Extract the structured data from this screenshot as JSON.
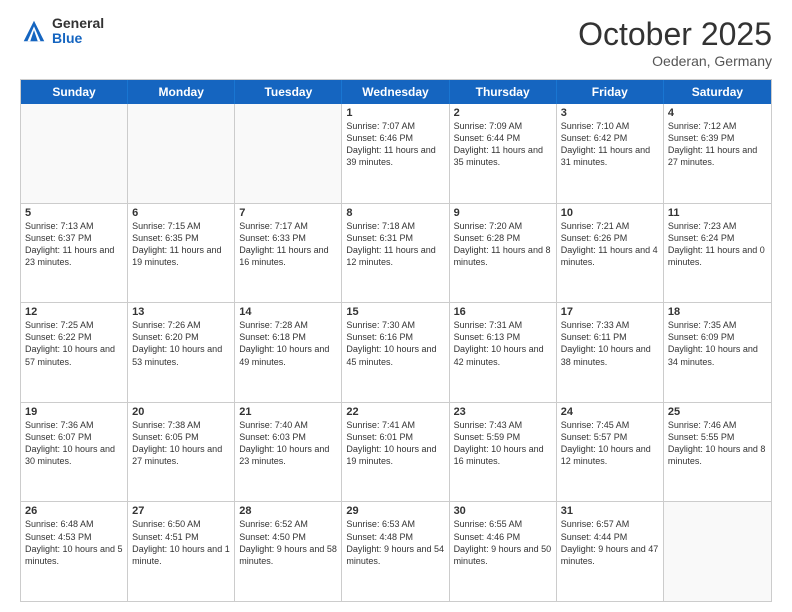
{
  "header": {
    "logo": {
      "general": "General",
      "blue": "Blue"
    },
    "title": "October 2025",
    "location": "Oederan, Germany"
  },
  "weekdays": [
    "Sunday",
    "Monday",
    "Tuesday",
    "Wednesday",
    "Thursday",
    "Friday",
    "Saturday"
  ],
  "rows": [
    [
      {
        "day": "",
        "sunrise": "",
        "sunset": "",
        "daylight": ""
      },
      {
        "day": "",
        "sunrise": "",
        "sunset": "",
        "daylight": ""
      },
      {
        "day": "",
        "sunrise": "",
        "sunset": "",
        "daylight": ""
      },
      {
        "day": "1",
        "sunrise": "Sunrise: 7:07 AM",
        "sunset": "Sunset: 6:46 PM",
        "daylight": "Daylight: 11 hours and 39 minutes."
      },
      {
        "day": "2",
        "sunrise": "Sunrise: 7:09 AM",
        "sunset": "Sunset: 6:44 PM",
        "daylight": "Daylight: 11 hours and 35 minutes."
      },
      {
        "day": "3",
        "sunrise": "Sunrise: 7:10 AM",
        "sunset": "Sunset: 6:42 PM",
        "daylight": "Daylight: 11 hours and 31 minutes."
      },
      {
        "day": "4",
        "sunrise": "Sunrise: 7:12 AM",
        "sunset": "Sunset: 6:39 PM",
        "daylight": "Daylight: 11 hours and 27 minutes."
      }
    ],
    [
      {
        "day": "5",
        "sunrise": "Sunrise: 7:13 AM",
        "sunset": "Sunset: 6:37 PM",
        "daylight": "Daylight: 11 hours and 23 minutes."
      },
      {
        "day": "6",
        "sunrise": "Sunrise: 7:15 AM",
        "sunset": "Sunset: 6:35 PM",
        "daylight": "Daylight: 11 hours and 19 minutes."
      },
      {
        "day": "7",
        "sunrise": "Sunrise: 7:17 AM",
        "sunset": "Sunset: 6:33 PM",
        "daylight": "Daylight: 11 hours and 16 minutes."
      },
      {
        "day": "8",
        "sunrise": "Sunrise: 7:18 AM",
        "sunset": "Sunset: 6:31 PM",
        "daylight": "Daylight: 11 hours and 12 minutes."
      },
      {
        "day": "9",
        "sunrise": "Sunrise: 7:20 AM",
        "sunset": "Sunset: 6:28 PM",
        "daylight": "Daylight: 11 hours and 8 minutes."
      },
      {
        "day": "10",
        "sunrise": "Sunrise: 7:21 AM",
        "sunset": "Sunset: 6:26 PM",
        "daylight": "Daylight: 11 hours and 4 minutes."
      },
      {
        "day": "11",
        "sunrise": "Sunrise: 7:23 AM",
        "sunset": "Sunset: 6:24 PM",
        "daylight": "Daylight: 11 hours and 0 minutes."
      }
    ],
    [
      {
        "day": "12",
        "sunrise": "Sunrise: 7:25 AM",
        "sunset": "Sunset: 6:22 PM",
        "daylight": "Daylight: 10 hours and 57 minutes."
      },
      {
        "day": "13",
        "sunrise": "Sunrise: 7:26 AM",
        "sunset": "Sunset: 6:20 PM",
        "daylight": "Daylight: 10 hours and 53 minutes."
      },
      {
        "day": "14",
        "sunrise": "Sunrise: 7:28 AM",
        "sunset": "Sunset: 6:18 PM",
        "daylight": "Daylight: 10 hours and 49 minutes."
      },
      {
        "day": "15",
        "sunrise": "Sunrise: 7:30 AM",
        "sunset": "Sunset: 6:16 PM",
        "daylight": "Daylight: 10 hours and 45 minutes."
      },
      {
        "day": "16",
        "sunrise": "Sunrise: 7:31 AM",
        "sunset": "Sunset: 6:13 PM",
        "daylight": "Daylight: 10 hours and 42 minutes."
      },
      {
        "day": "17",
        "sunrise": "Sunrise: 7:33 AM",
        "sunset": "Sunset: 6:11 PM",
        "daylight": "Daylight: 10 hours and 38 minutes."
      },
      {
        "day": "18",
        "sunrise": "Sunrise: 7:35 AM",
        "sunset": "Sunset: 6:09 PM",
        "daylight": "Daylight: 10 hours and 34 minutes."
      }
    ],
    [
      {
        "day": "19",
        "sunrise": "Sunrise: 7:36 AM",
        "sunset": "Sunset: 6:07 PM",
        "daylight": "Daylight: 10 hours and 30 minutes."
      },
      {
        "day": "20",
        "sunrise": "Sunrise: 7:38 AM",
        "sunset": "Sunset: 6:05 PM",
        "daylight": "Daylight: 10 hours and 27 minutes."
      },
      {
        "day": "21",
        "sunrise": "Sunrise: 7:40 AM",
        "sunset": "Sunset: 6:03 PM",
        "daylight": "Daylight: 10 hours and 23 minutes."
      },
      {
        "day": "22",
        "sunrise": "Sunrise: 7:41 AM",
        "sunset": "Sunset: 6:01 PM",
        "daylight": "Daylight: 10 hours and 19 minutes."
      },
      {
        "day": "23",
        "sunrise": "Sunrise: 7:43 AM",
        "sunset": "Sunset: 5:59 PM",
        "daylight": "Daylight: 10 hours and 16 minutes."
      },
      {
        "day": "24",
        "sunrise": "Sunrise: 7:45 AM",
        "sunset": "Sunset: 5:57 PM",
        "daylight": "Daylight: 10 hours and 12 minutes."
      },
      {
        "day": "25",
        "sunrise": "Sunrise: 7:46 AM",
        "sunset": "Sunset: 5:55 PM",
        "daylight": "Daylight: 10 hours and 8 minutes."
      }
    ],
    [
      {
        "day": "26",
        "sunrise": "Sunrise: 6:48 AM",
        "sunset": "Sunset: 4:53 PM",
        "daylight": "Daylight: 10 hours and 5 minutes."
      },
      {
        "day": "27",
        "sunrise": "Sunrise: 6:50 AM",
        "sunset": "Sunset: 4:51 PM",
        "daylight": "Daylight: 10 hours and 1 minute."
      },
      {
        "day": "28",
        "sunrise": "Sunrise: 6:52 AM",
        "sunset": "Sunset: 4:50 PM",
        "daylight": "Daylight: 9 hours and 58 minutes."
      },
      {
        "day": "29",
        "sunrise": "Sunrise: 6:53 AM",
        "sunset": "Sunset: 4:48 PM",
        "daylight": "Daylight: 9 hours and 54 minutes."
      },
      {
        "day": "30",
        "sunrise": "Sunrise: 6:55 AM",
        "sunset": "Sunset: 4:46 PM",
        "daylight": "Daylight: 9 hours and 50 minutes."
      },
      {
        "day": "31",
        "sunrise": "Sunrise: 6:57 AM",
        "sunset": "Sunset: 4:44 PM",
        "daylight": "Daylight: 9 hours and 47 minutes."
      },
      {
        "day": "",
        "sunrise": "",
        "sunset": "",
        "daylight": ""
      }
    ]
  ]
}
